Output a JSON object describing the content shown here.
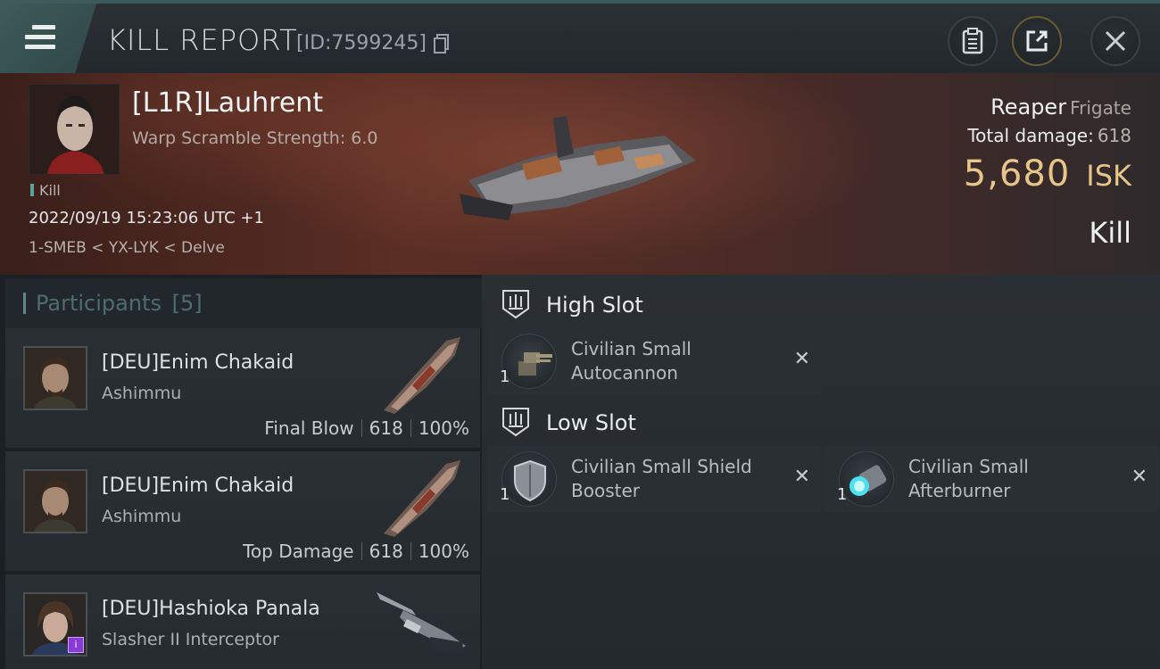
{
  "header": {
    "title": "KILL REPORT",
    "report_id": "[ID:7599245]",
    "icons": [
      "menu-icon",
      "copy-icon",
      "clipboard-icon",
      "share-icon",
      "close-icon"
    ]
  },
  "victim": {
    "name": "[L1R]Lauhrent",
    "subtitle": "Warp Scramble Strength: 6.0",
    "tag": "Kill",
    "timestamp": "2022/09/19 15:23:06 UTC +1",
    "location": "1-SMEB < YX-LYK < Delve",
    "ship": "Reaper",
    "ship_class": "Frigate",
    "total_damage_label": "Total damage:",
    "total_damage": "618",
    "isk_value": "5,680",
    "isk_unit": "ISK",
    "result": "Kill"
  },
  "participants": {
    "title": "Participants",
    "count": "[5]",
    "items": [
      {
        "name": "[DEU]Enim Chakaid",
        "ship": "Ashimmu",
        "role": "Final Blow",
        "damage": "618",
        "percent": "100%"
      },
      {
        "name": "[DEU]Enim Chakaid",
        "ship": "Ashimmu",
        "role": "Top Damage",
        "damage": "618",
        "percent": "100%"
      },
      {
        "name": "[DEU]Hashioka Panala",
        "ship": "Slasher II Interceptor",
        "role": "",
        "damage": "",
        "percent": ""
      }
    ]
  },
  "fittings": {
    "high_slot": {
      "label": "High Slot",
      "modules": [
        {
          "name_line1": "Civilian Small",
          "name_line2": "Autocannon",
          "qty": "1"
        }
      ]
    },
    "low_slot": {
      "label": "Low Slot",
      "modules": [
        {
          "name_line1": "Civilian Small Shield",
          "name_line2": "Booster",
          "qty": "1"
        },
        {
          "name_line1": "Civilian Small",
          "name_line2": "Afterburner",
          "qty": "1"
        }
      ]
    }
  },
  "colors": {
    "accent_teal": "#5f8784",
    "isk_gold": "#e7c58a",
    "banner_red": "#5a2e24"
  }
}
